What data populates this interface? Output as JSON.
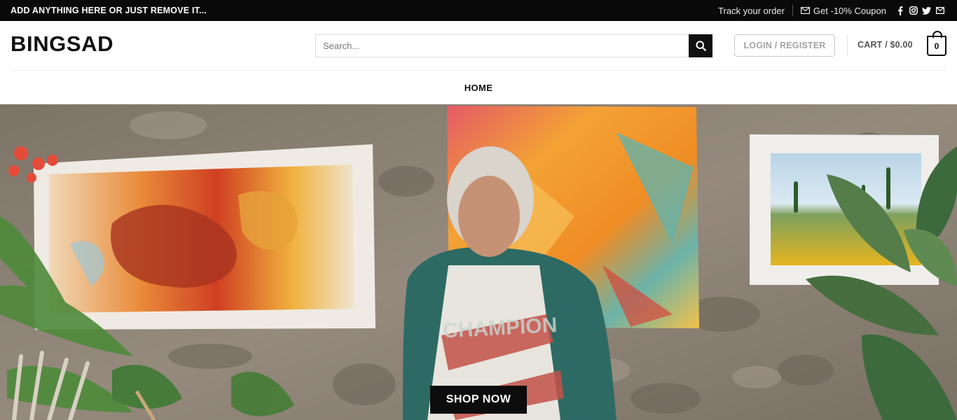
{
  "topbar": {
    "announcement": "ADD ANYTHING HERE OR JUST REMOVE IT...",
    "track_order": "Track your order",
    "coupon": "Get -10% Coupon",
    "social_icons": [
      "facebook-icon",
      "instagram-icon",
      "twitter-icon",
      "email-icon"
    ]
  },
  "header": {
    "logo": "BINGSAD",
    "search_placeholder": "Search...",
    "login_label": "LOGIN / REGISTER",
    "cart_label": "CART / $0.00",
    "cart_count": "0"
  },
  "nav": {
    "items": [
      {
        "label": "HOME"
      }
    ]
  },
  "hero": {
    "cta_label": "SHOP NOW"
  },
  "colors": {
    "topbar_bg": "#0a0a0a",
    "primary": "#111111",
    "muted": "#a3a3a3"
  }
}
